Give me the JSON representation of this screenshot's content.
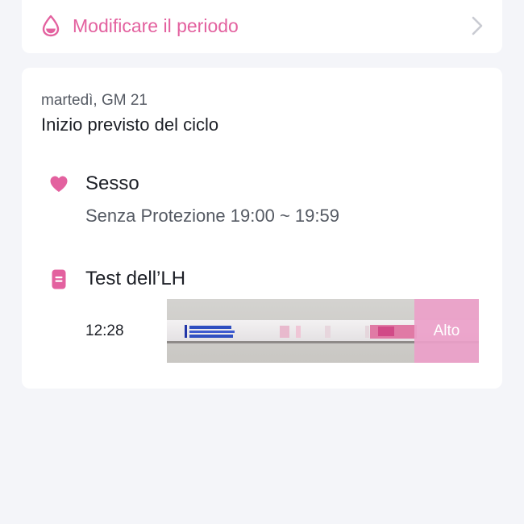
{
  "period_card": {
    "label": "Modificare il periodo",
    "icon": "drop-icon",
    "action_icon": "chevron-right-icon"
  },
  "day_card": {
    "date": "martedì, GM 21",
    "title": "Inizio previsto del ciclo",
    "sex": {
      "icon": "heart-icon",
      "title": "Sesso",
      "detail": "Senza Protezione 19:00 ~ 19:59"
    },
    "lh_test": {
      "icon": "document-icon",
      "title": "Test dell’LH",
      "time": "12:28",
      "result": "Alto"
    }
  },
  "colors": {
    "accent": "#e3619f",
    "background": "#f4f5f9",
    "card": "#ffffff",
    "result_overlay": "#eca0c9"
  }
}
